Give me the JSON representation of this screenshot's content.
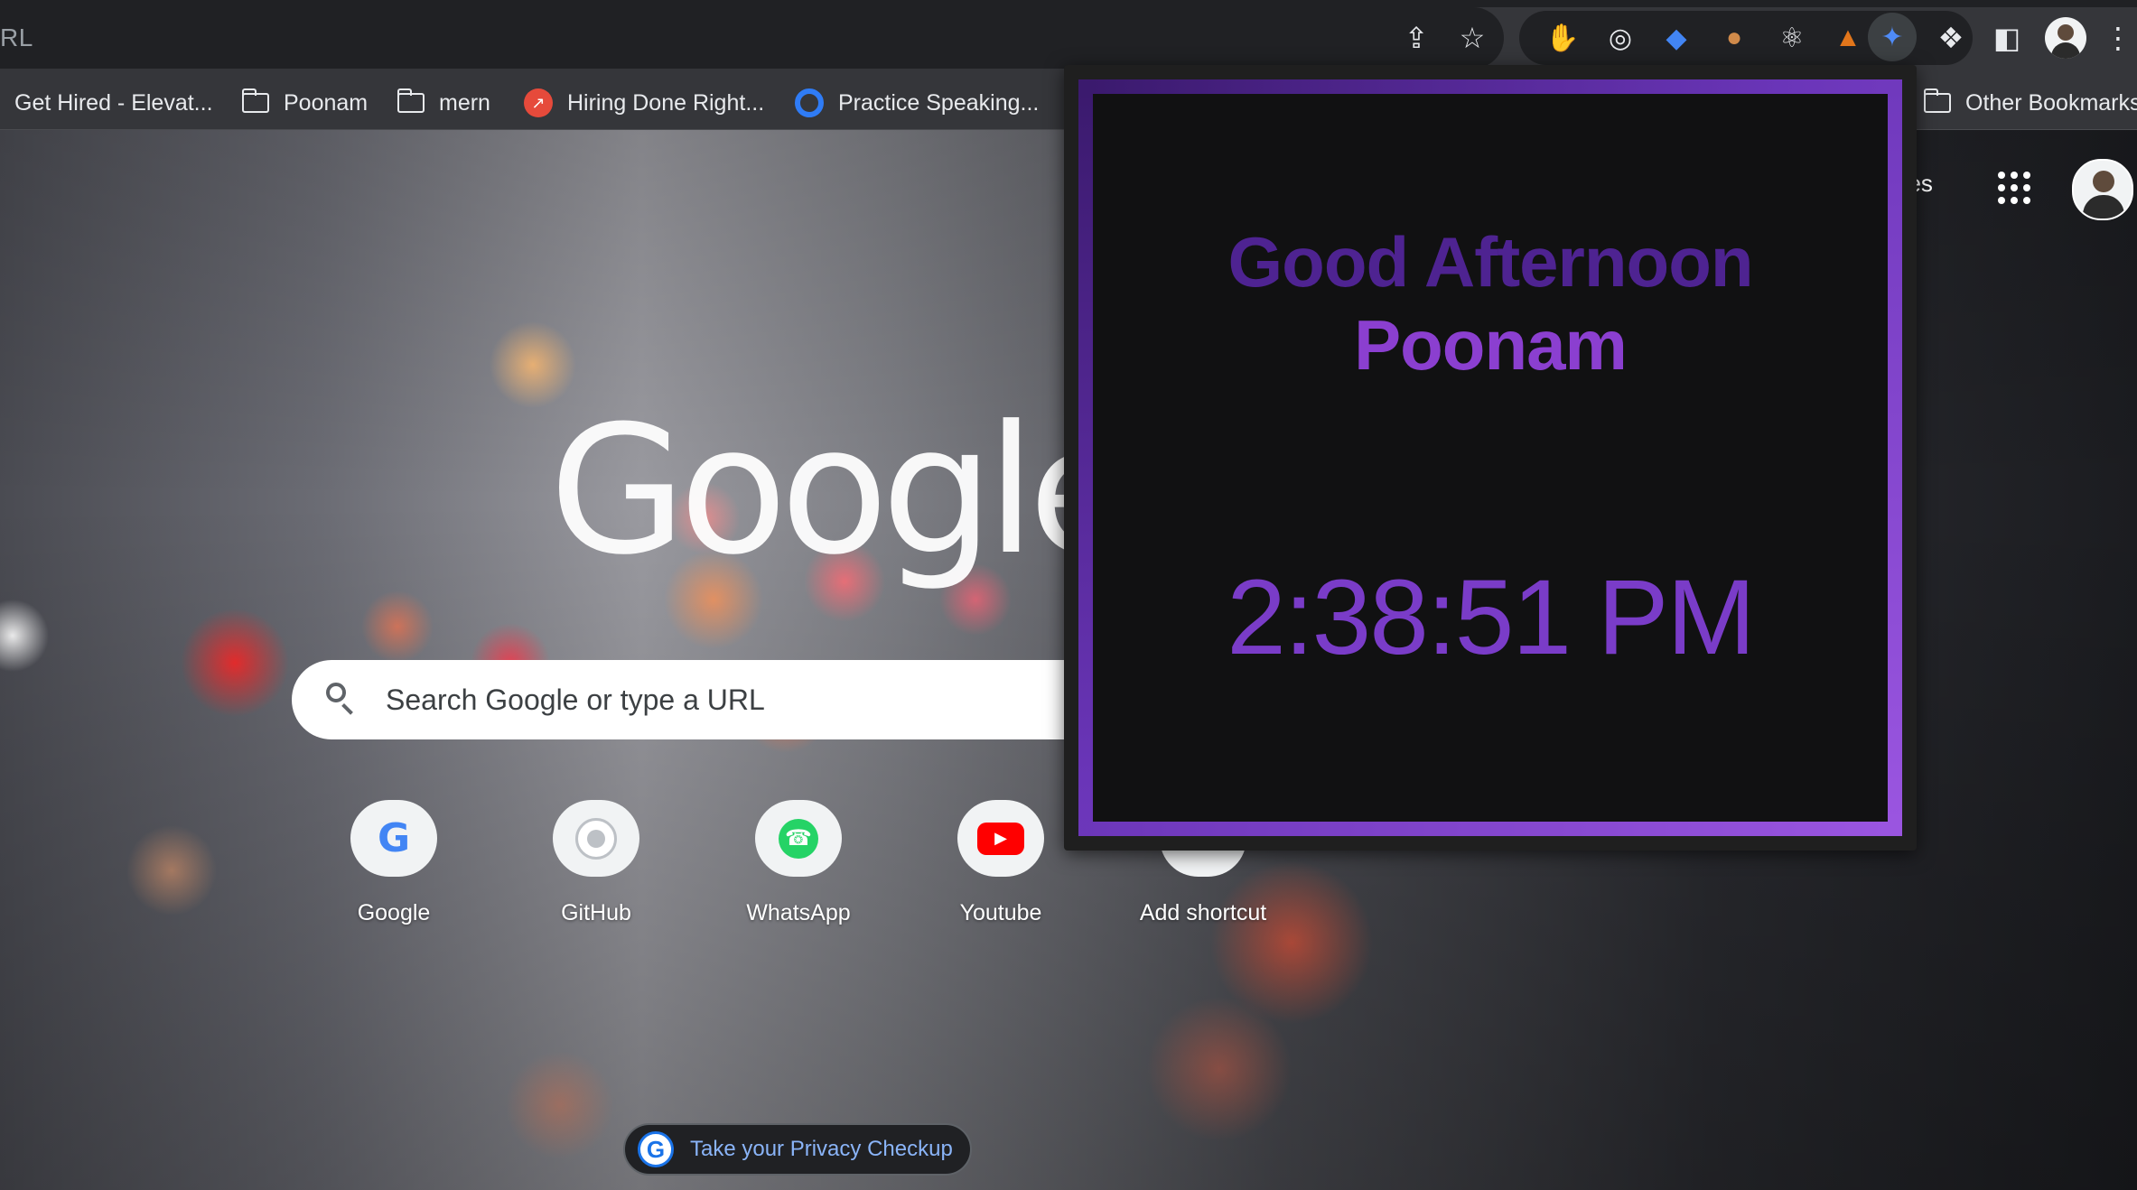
{
  "omnibox": {
    "text": "RL",
    "share_icon": "share-icon",
    "star_icon": "bookmark-star-icon"
  },
  "extensions": [
    {
      "name": "adblock-hand-icon",
      "color": "#e53935"
    },
    {
      "name": "target-ring-icon",
      "color": "#e8eaed"
    },
    {
      "name": "tag-icon",
      "color": "#4285f4"
    },
    {
      "name": "cookie-icon",
      "color": "#d08a4a"
    },
    {
      "name": "react-atom-icon",
      "color": "#e8eaed"
    },
    {
      "name": "metamask-fox-icon",
      "color": "#e2761b"
    },
    {
      "name": "puzzle-extension-active-icon",
      "color": "#4f8bf7"
    }
  ],
  "toolbar": {
    "extensions_icon": "puzzle-icon",
    "side_panel_icon": "side-panel-icon",
    "menu_icon": "kebab-menu-icon"
  },
  "bookmarks": {
    "items": [
      {
        "label": "Get Hired - Elevat...",
        "icon": "none"
      },
      {
        "label": "Poonam",
        "icon": "folder-icon"
      },
      {
        "label": "mern",
        "icon": "folder-icon"
      },
      {
        "label": "Hiring Done Right...",
        "icon": "rocket-favicon"
      },
      {
        "label": "Practice Speaking...",
        "icon": "ring-favicon"
      }
    ],
    "other": "Other Bookmarks"
  },
  "ntp": {
    "images_link": "ges",
    "logo": "Google",
    "search_placeholder": "Search Google or type a URL",
    "shortcuts": [
      {
        "label": "Google"
      },
      {
        "label": "GitHub"
      },
      {
        "label": "WhatsApp"
      },
      {
        "label": "Youtube"
      },
      {
        "label": "Add shortcut"
      }
    ],
    "privacy_checkup": "Take your Privacy Checkup"
  },
  "popup": {
    "greeting_line1": "Good Afternoon",
    "greeting_line2": "Poonam",
    "time": "2:38:51 PM",
    "accent": "#7a3cc8"
  }
}
